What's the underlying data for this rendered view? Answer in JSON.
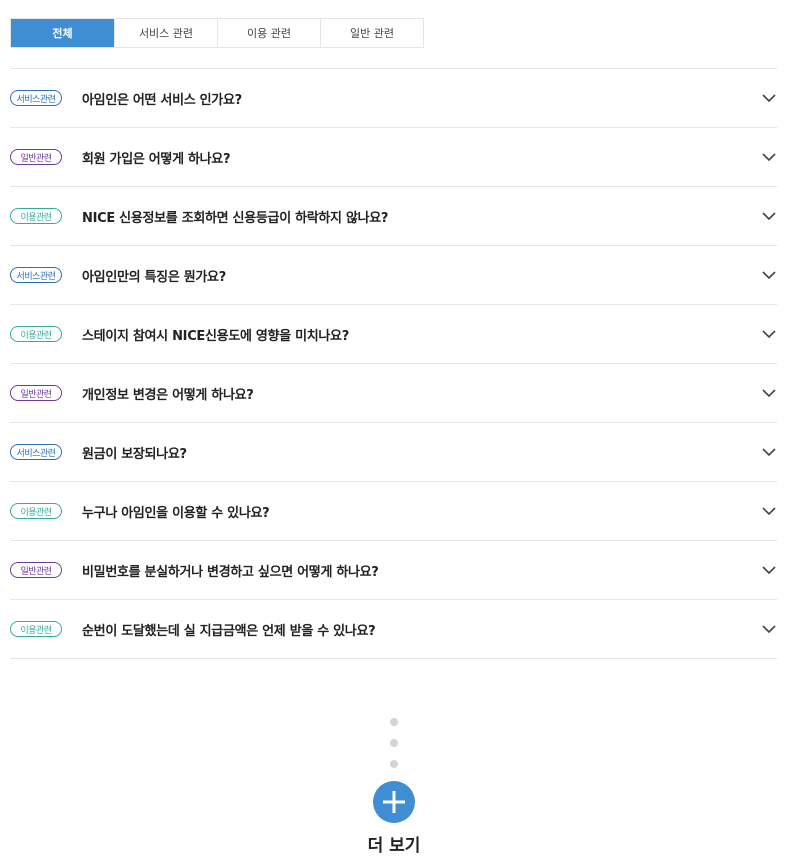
{
  "tabs": [
    {
      "label": "전체",
      "active": true
    },
    {
      "label": "서비스 관련",
      "active": false
    },
    {
      "label": "이용 관련",
      "active": false
    },
    {
      "label": "일반 관련",
      "active": false
    }
  ],
  "faq": [
    {
      "badge": "서비스관련",
      "type": "service",
      "question": "아임인은 어떤 서비스 인가요?"
    },
    {
      "badge": "일반관련",
      "type": "general",
      "question": "회원 가입은 어떻게 하나요?"
    },
    {
      "badge": "이용관련",
      "type": "usage",
      "question": "NICE 신용정보를 조회하면 신용등급이 하락하지 않나요?"
    },
    {
      "badge": "서비스관련",
      "type": "service",
      "question": "아임인만의 특징은 뭔가요?"
    },
    {
      "badge": "이용관련",
      "type": "usage",
      "question": "스테이지 참여시 NICE신용도에 영향을 미치나요?"
    },
    {
      "badge": "일반관련",
      "type": "general",
      "question": "개인정보 변경은 어떻게 하나요?"
    },
    {
      "badge": "서비스관련",
      "type": "service",
      "question": "원금이 보장되나요?"
    },
    {
      "badge": "이용관련",
      "type": "usage",
      "question": "누구나 아임인을 이용할 수 있나요?"
    },
    {
      "badge": "일반관련",
      "type": "general",
      "question": "비밀번호를 분실하거나 변경하고 싶으면 어떻게 하나요?"
    },
    {
      "badge": "이용관련",
      "type": "usage",
      "question": "순번이 도달했는데 실 지급금액은 언제 받을 수 있나요?"
    }
  ],
  "more": {
    "label": "더 보기",
    "icon": "plus-icon"
  },
  "colors": {
    "accent": "#3f8dd3",
    "service": "#2f6fb5",
    "general": "#6c3d96",
    "usage": "#34ad9c"
  }
}
